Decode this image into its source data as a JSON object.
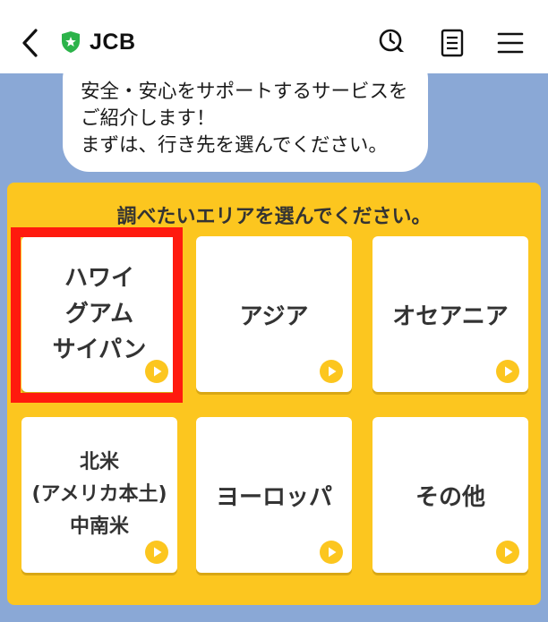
{
  "header": {
    "brand": "JCB",
    "colors": {
      "brand_shield": "#2cb34a"
    }
  },
  "chat": {
    "message": "安全・安心をサポートするサービスをご紹介します！\nまずは、行き先を選んでください。"
  },
  "menu": {
    "title": "調べたいエリアを選んでください。",
    "accent": "#fcc61f",
    "areas": [
      {
        "label": "ハワイ\nグアム\nサイパン"
      },
      {
        "label": "アジア"
      },
      {
        "label": "オセアニア"
      },
      {
        "label": "北米\n(アメリカ本土)\n中南米"
      },
      {
        "label": "ヨーロッパ"
      },
      {
        "label": "その他"
      }
    ],
    "highlight_color": "#ff1a0e"
  }
}
